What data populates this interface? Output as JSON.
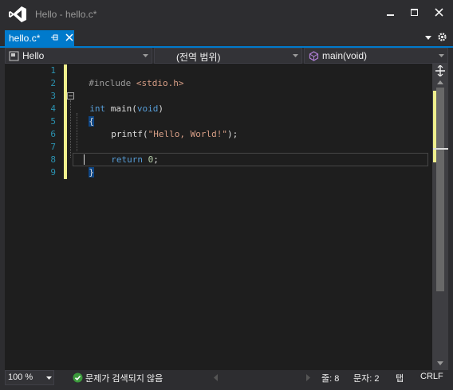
{
  "window": {
    "title": "Hello - hello.c*"
  },
  "tabs": [
    {
      "label": "hello.c*",
      "active": true
    }
  ],
  "navbar": {
    "project": "Hello",
    "scope": "(전역 범위)",
    "member": "main(void)"
  },
  "editor": {
    "line_numbers": [
      "1",
      "2",
      "3",
      "4",
      "5",
      "6",
      "7",
      "8",
      "9"
    ],
    "code": {
      "l1_directive": "#include",
      "l1_header": " <stdio.h>",
      "l3_type": "int",
      "l3_name": " main(",
      "l3_param": "void",
      "l3_close": ")",
      "l4": "{",
      "l5_fn": "printf(",
      "l5_str": "\"Hello, World!\"",
      "l5_end": ");",
      "l7_kw": "return",
      "l7_num": " 0",
      "l7_end": ";",
      "l8": "}"
    }
  },
  "statusbar": {
    "zoom": "100 %",
    "issues": "문제가 검색되지 않음",
    "line": "줄: 8",
    "col": "문자: 2",
    "indent": "탭",
    "eol": "CRLF"
  },
  "colors": {
    "accent": "#007acc",
    "change_margin": "#efef8d",
    "line_number": "#2b91af",
    "keyword": "#569cd6",
    "string": "#d69d85"
  }
}
